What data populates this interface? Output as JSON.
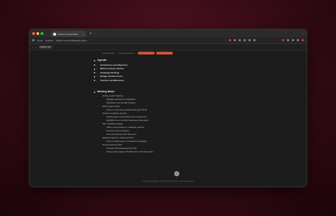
{
  "browser": {
    "tab_title": "Product Launch Mark...",
    "new_tab": "+",
    "toolbar_home": "Home",
    "toolbar_projects": "Projects",
    "toolbar_doc": "Product Launch Marketing Camp...",
    "address_pill": "Untitled doc"
  },
  "doc": {
    "meta": "Last edited by ... Type keywords to ...",
    "agenda": {
      "title": "Agenda",
      "items": [
        "Introduction and Objectives",
        "Market Analysis Review",
        "Campaign Strategy",
        "Budget and Resources",
        "Timeline and Milestones"
      ]
    },
    "notes": {
      "title": "Meeting Notes",
      "lines": [
        "Outline product features",
        "Highlight advanced AI capabilities",
        "Emphasize user-friendly interface",
        "Define target market",
        "Focus on tech-savvy professionals aged 25-40",
        "Conduct competitor analysis",
        "Identify gaps in personalized user experiences",
        "Highlight how our product addresses these gaps",
        "Plan marketing strategy",
        "Utilize social media as a marketing channel",
        "Develop email newsletters",
        "Form partnerships with influencers",
        "Allocate budget for marketing efforts",
        "Focus on high-impact, cost-effective strategies",
        "Set and track key KPIs",
        "Increase brand awareness by 20%",
        "Achieve sales target of 50,000 units in the first quarter"
      ]
    },
    "footer": "Created in Capacities · Notebook for thoughts, notes & knowledge"
  },
  "colors": {
    "accent": "#d2523b",
    "record": "#e0384a"
  }
}
